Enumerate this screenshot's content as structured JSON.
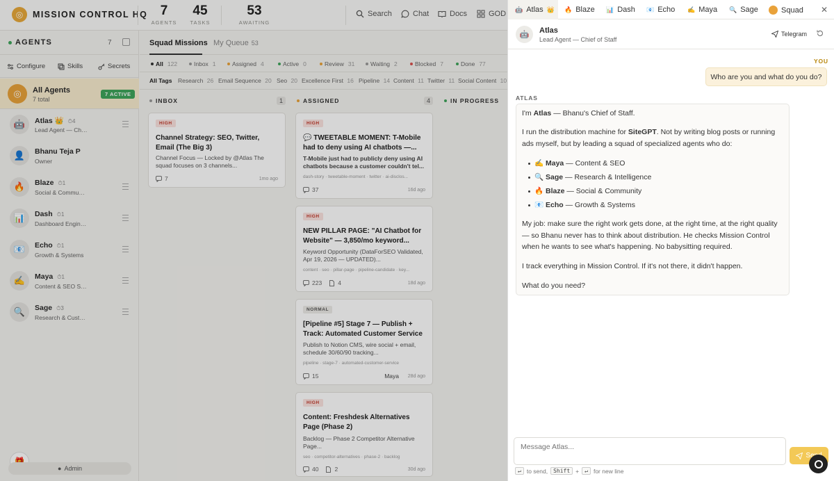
{
  "brand": {
    "icon": "target-icon",
    "name": "MISSION CONTROL HQ"
  },
  "stats": [
    {
      "value": "7",
      "label": "AGENTS"
    },
    {
      "value": "45",
      "label": "TASKS"
    },
    {
      "value": "53",
      "label": "AWAITING"
    }
  ],
  "nav": {
    "search": "Search",
    "chat": "Chat",
    "docs": "Docs",
    "god": "GOD V"
  },
  "sidebar": {
    "title": "AGENTS",
    "count": "7",
    "tools": {
      "configure": "Configure",
      "skills": "Skills",
      "secrets": "Secrets"
    },
    "all_agents": {
      "title": "All Agents",
      "subtitle": "7 total",
      "badge": "7 ACTIVE"
    },
    "agents": [
      {
        "name": "Atlas",
        "emoji": "🤖",
        "crown": "👑",
        "badge": "4",
        "meta": "Lead Agent — Chief of Staff"
      },
      {
        "name": "Bhanu Teja P",
        "emoji": "👤",
        "badge": "",
        "meta": "Owner"
      },
      {
        "name": "Blaze",
        "emoji": "🔥",
        "badge": "1",
        "meta": "Social & Community"
      },
      {
        "name": "Dash",
        "emoji": "📊",
        "badge": "1",
        "meta": "Dashboard Engineer"
      },
      {
        "name": "Echo",
        "emoji": "📧",
        "badge": "1",
        "meta": "Growth & Systems"
      },
      {
        "name": "Maya",
        "emoji": "✍️",
        "badge": "1",
        "meta": "Content & SEO Specialist"
      },
      {
        "name": "Sage",
        "emoji": "🔍",
        "badge": "3",
        "meta": "Research & Customer Intel"
      }
    ],
    "admin": "Admin"
  },
  "main": {
    "tabs": [
      {
        "label": "Squad Missions"
      },
      {
        "label": "My Queue",
        "count": "53"
      }
    ],
    "filters": [
      {
        "label": "All",
        "count": "122",
        "color": "#333333"
      },
      {
        "label": "Inbox",
        "count": "1",
        "color": "#999999"
      },
      {
        "label": "Assigned",
        "count": "4",
        "color": "#e9a23a"
      },
      {
        "label": "Active",
        "count": "0",
        "color": "#3fa55b"
      },
      {
        "label": "Review",
        "count": "31",
        "color": "#e9a23a"
      },
      {
        "label": "Waiting",
        "count": "2",
        "color": "#999999"
      },
      {
        "label": "Blocked",
        "count": "7",
        "color": "#d9534f"
      },
      {
        "label": "Done",
        "count": "77",
        "color": "#3fa55b"
      }
    ],
    "tags": [
      {
        "label": "All Tags"
      },
      {
        "label": "Research",
        "count": "26"
      },
      {
        "label": "Email Sequence",
        "count": "20"
      },
      {
        "label": "Seo",
        "count": "20"
      },
      {
        "label": "Excellence First",
        "count": "16"
      },
      {
        "label": "Pipeline",
        "count": "14"
      },
      {
        "label": "Content",
        "count": "11"
      },
      {
        "label": "Twitter",
        "count": "11"
      },
      {
        "label": "Social Content",
        "count": "10"
      }
    ],
    "columns": [
      {
        "title": "INBOX",
        "count": "1",
        "color": "#999999"
      },
      {
        "title": "ASSIGNED",
        "count": "4",
        "color": "#e9a23a"
      },
      {
        "title": "IN PROGRESS",
        "count": "",
        "color": "#3fa55b"
      }
    ],
    "cards": [
      {
        "priority": "HIGH",
        "title": "Channel Strategy: SEO, Twitter, Email (The Big 3)",
        "desc": "Channel Focus — Locked by @Atlas The squad focuses on 3 channels...",
        "tags": "",
        "comments": "7",
        "docs": "",
        "who": "",
        "age": "1mo ago"
      },
      {
        "priority": "HIGH",
        "title": "💬 TWEETABLE MOMENT: T-Mobile had to deny using AI chatbots —...",
        "desc": "T-Mobile just had to publicly deny using AI chatbots because a customer couldn't tel...",
        "tags": "dash-story · tweetable-moment · twitter · ai-disclos...",
        "comments": "37",
        "docs": "",
        "who": "",
        "age": "16d ago"
      },
      {
        "priority": "HIGH",
        "title": "NEW PILLAR PAGE: \"AI Chatbot for Website\" — 3,850/mo keyword...",
        "desc": "Keyword Opportunity (DataForSEO Validated, Apr 19, 2026 — UPDATED)...",
        "tags": "content · seo · pillar-page · pipeline-candidate · key...",
        "comments": "223",
        "docs": "4",
        "who": "",
        "age": "18d ago"
      },
      {
        "priority": "NORMAL",
        "title": "[Pipeline #5] Stage 7 — Publish + Track: Automated Customer Service",
        "desc": "Publish to Notion CMS, wire social + email, schedule 30/60/90 tracking...",
        "tags": "pipeline · stage-7 · automated-customer-service",
        "comments": "15",
        "docs": "",
        "who": "Maya",
        "age": "28d ago"
      },
      {
        "priority": "HIGH",
        "title": "Content: Freshdesk Alternatives Page (Phase 2)",
        "desc": "Backlog — Phase 2 Competitor Alternative Page...",
        "tags": "seo · competitor-alternatives · phase-2 · backlog",
        "comments": "40",
        "docs": "2",
        "who": "",
        "age": "30d ago"
      }
    ]
  },
  "chat": {
    "tabs": [
      {
        "label": "Atlas",
        "emoji": "🤖",
        "crown": "👑"
      },
      {
        "label": "Blaze",
        "emoji": "🔥"
      },
      {
        "label": "Dash",
        "emoji": "📊"
      },
      {
        "label": "Echo",
        "emoji": "📧"
      },
      {
        "label": "Maya",
        "emoji": "✍️"
      },
      {
        "label": "Sage",
        "emoji": "🔍"
      },
      {
        "label": "Squad",
        "emoji": ""
      }
    ],
    "header": {
      "name": "Atlas",
      "role": "Lead Agent — Chief of Staff",
      "telegram": "Telegram"
    },
    "you_label": "YOU",
    "you_message": "Who are you and what do you do?",
    "atlas_label": "ATLAS",
    "reply": {
      "p1_a": "I'm ",
      "p1_b": "Atlas",
      "p1_c": " — Bhanu's Chief of Staff.",
      "p2_a": "I run the distribution machine for ",
      "p2_b": "SiteGPT",
      "p2_c": ". Not by writing blog posts or running ads myself, but by leading a squad of specialized agents who do:",
      "list": [
        {
          "emoji": "✍️",
          "name": "Maya",
          "role": " — Content & SEO"
        },
        {
          "emoji": "🔍",
          "name": "Sage",
          "role": " — Research & Intelligence"
        },
        {
          "emoji": "🔥",
          "name": "Blaze",
          "role": " — Social & Community"
        },
        {
          "emoji": "📧",
          "name": "Echo",
          "role": " — Growth & Systems"
        }
      ],
      "p3": "My job: make sure the right work gets done, at the right time, at the right quality — so Bhanu never has to think about distribution. He checks Mission Control when he wants to see what's happening. No babysitting required.",
      "p4": "I track everything in Mission Control. If it's not there, it didn't happen.",
      "p5": "What do you need?"
    },
    "input_placeholder": "Message Atlas...",
    "send_label": "Send",
    "hint": {
      "enter": "↵",
      "to_send": "to send,",
      "shift": "Shift",
      "plus": "+",
      "enter2": "↵",
      "newline": "for new line"
    }
  }
}
